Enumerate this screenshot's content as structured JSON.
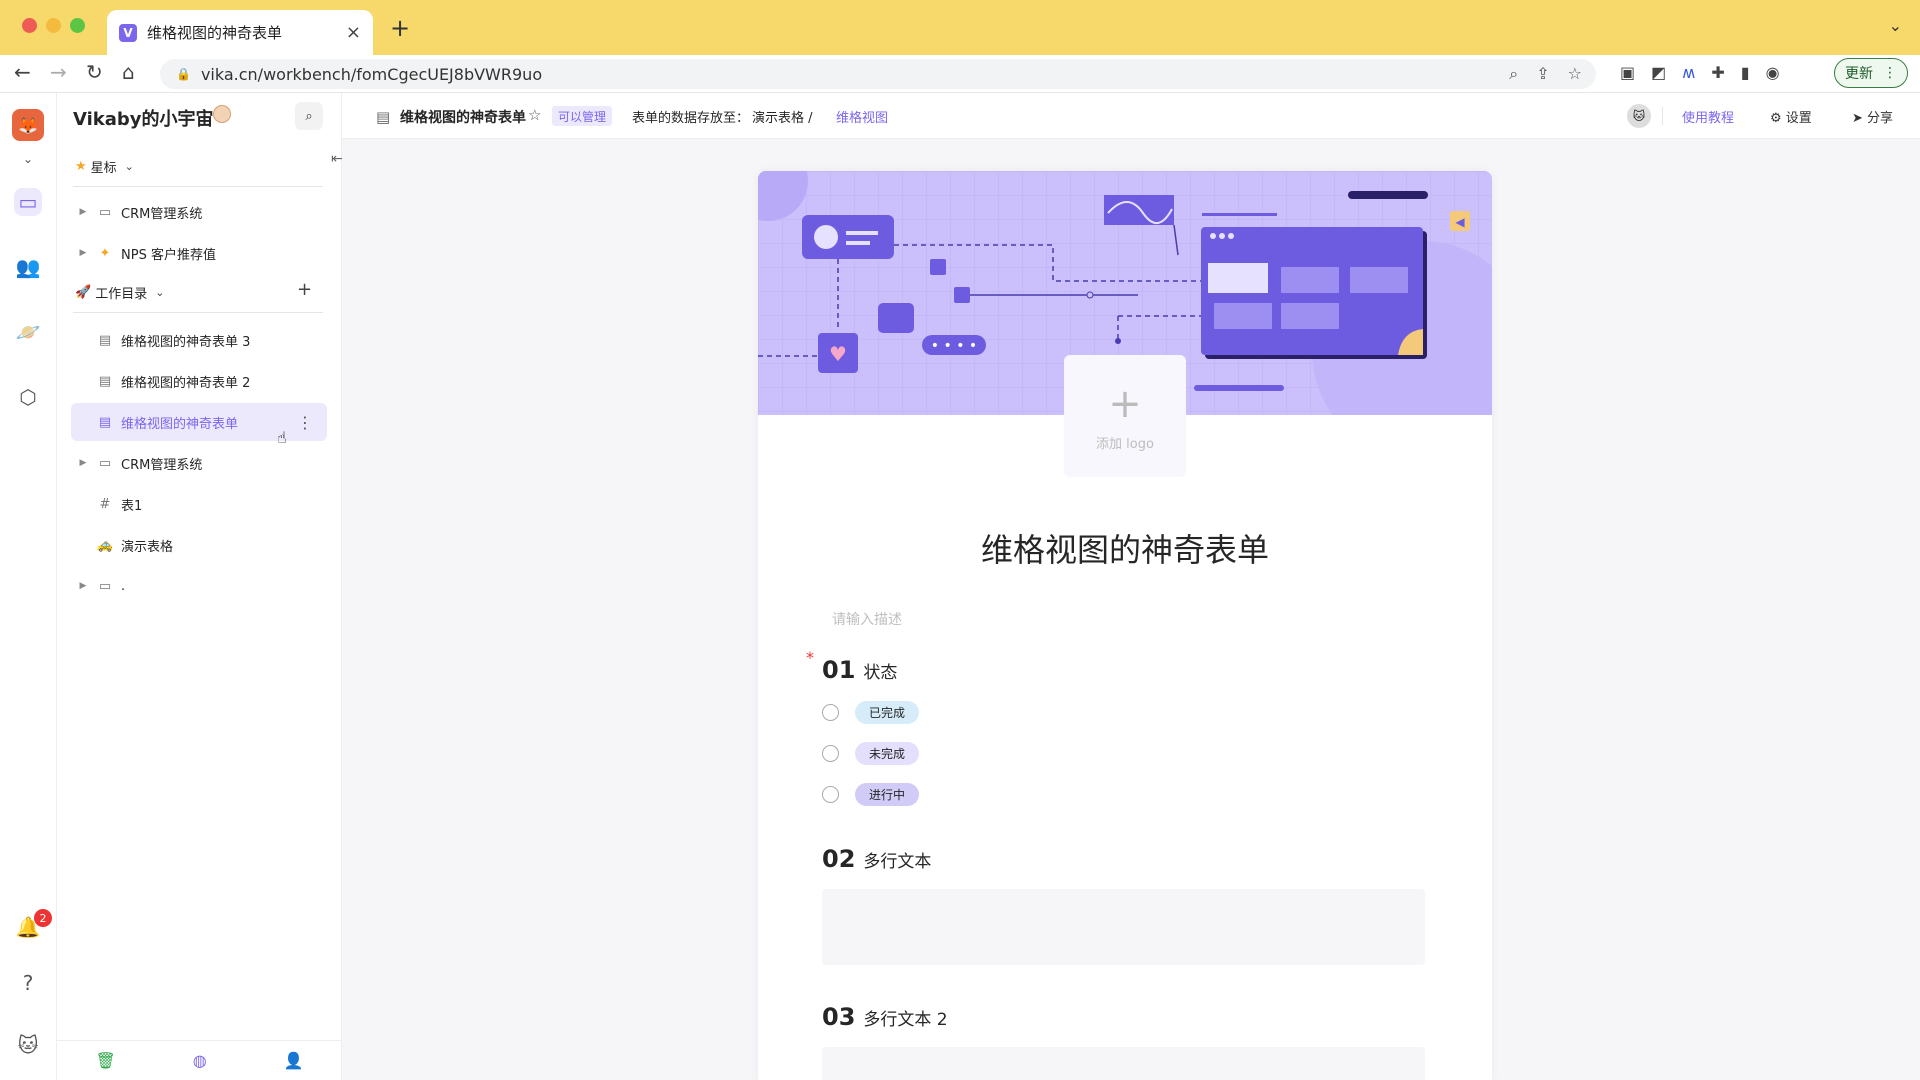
{
  "browser": {
    "tab_title": "维格视图的神奇表单",
    "url": "vika.cn/workbench/fomCgecUEJ8bVWR9uo",
    "update_label": "更新"
  },
  "rail": {
    "notification_count": "2"
  },
  "sidebar": {
    "space_name": "Vikaby的小宇宙",
    "starred_label": "星标",
    "starred_items": [
      {
        "label": "CRM管理系统",
        "icon": "folder-icon"
      },
      {
        "label": "NPS 客户推荐值",
        "icon": "star-emoji-icon"
      }
    ],
    "catalog_label": "工作目录",
    "catalog_items": [
      {
        "label": "维格视图的神奇表单 3",
        "icon": "form-icon"
      },
      {
        "label": "维格视图的神奇表单 2",
        "icon": "form-icon"
      },
      {
        "label": "维格视图的神奇表单",
        "icon": "form-icon"
      },
      {
        "label": "CRM管理系统",
        "icon": "folder-icon"
      },
      {
        "label": "表1",
        "icon": "grid-icon"
      },
      {
        "label": "演示表格",
        "icon": "car-emoji-icon"
      },
      {
        "label": ".",
        "icon": "folder-icon"
      }
    ]
  },
  "topbar": {
    "doc_title": "维格视图的神奇表单",
    "permission": "可以管理",
    "saved_to_label": "表单的数据存放至：",
    "saved_sheet": "演示表格 /",
    "saved_view": "维格视图",
    "help": "使用教程",
    "settings": "设置",
    "share": "分享"
  },
  "form": {
    "add_logo": "添加 logo",
    "title": "维格视图的神奇表单",
    "description_placeholder": "请输入描述",
    "questions": [
      {
        "num": "01",
        "label": "状态",
        "required": true,
        "options": [
          {
            "label": "已完成",
            "color": "#d6ecf9"
          },
          {
            "label": "未完成",
            "color": "#e4dffc"
          },
          {
            "label": "进行中",
            "color": "#d1cbf7"
          }
        ]
      },
      {
        "num": "02",
        "label": "多行文本"
      },
      {
        "num": "03",
        "label": "多行文本 2"
      }
    ]
  },
  "colors": {
    "accent": "#7b67ee",
    "chrome": "#f7d96b",
    "cover": "#cbc0fb"
  }
}
